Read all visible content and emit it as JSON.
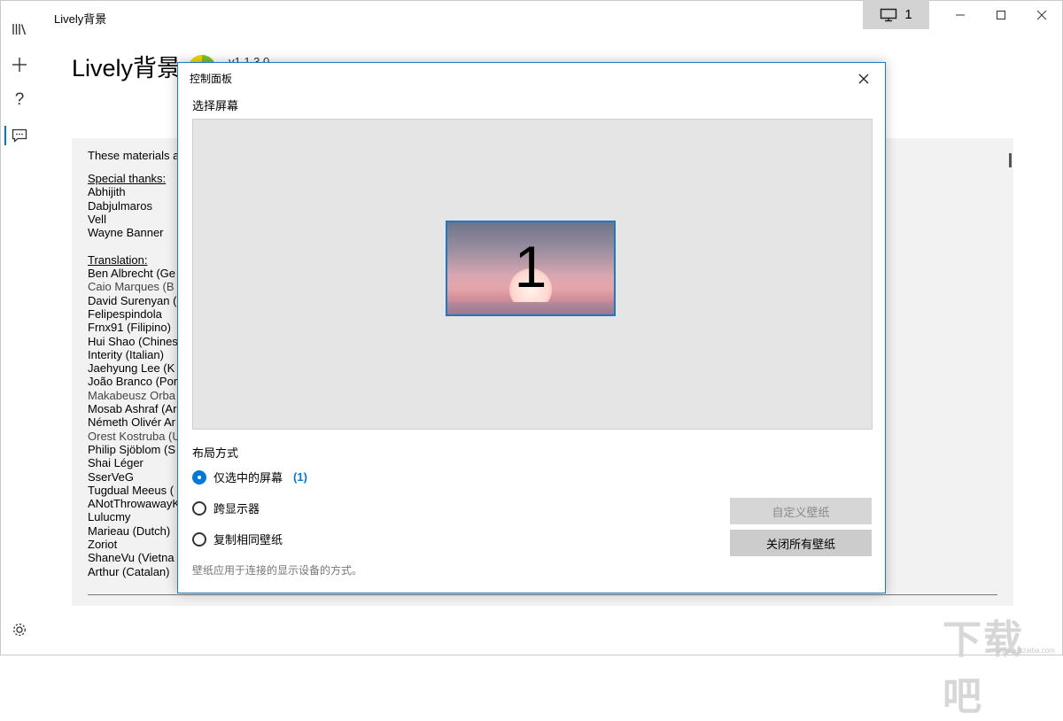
{
  "window": {
    "title": "Lively背景",
    "monitor_label": "1",
    "icons": {
      "monitor": "monitor-icon",
      "minimize": "minimize-icon",
      "maximize": "maximize-icon",
      "close": "close-icon"
    }
  },
  "sidebar": {
    "items": [
      {
        "name": "library",
        "icon": "library-icon"
      },
      {
        "name": "add",
        "icon": "plus-icon"
      },
      {
        "name": "help",
        "icon": "question-icon"
      },
      {
        "name": "about",
        "icon": "chat-icon",
        "active": true
      }
    ],
    "settings_icon": "gear-icon"
  },
  "main": {
    "title": "Lively背景",
    "version": "v1.1.3.0",
    "credits": {
      "intro": "These materials a",
      "special_thanks_header": "Special thanks:",
      "special_thanks": [
        "Abhijith",
        "Dabjulmaros",
        "Vell",
        "Wayne Banner"
      ],
      "translation_header": "Translation:",
      "translators": [
        "Ben Albrecht (Ge",
        "Caio Marques (B",
        "David Surenyan (",
        "Felipespindola",
        "Frnx91 (Filipino)",
        "Hui Shao (Chines",
        "Interity (Italian)",
        "Jaehyung Lee (K",
        "João Branco (Por",
        "Makabeusz Orba",
        "Mosab Ashraf (Ar",
        "Németh Olivér Ar",
        "Orest Kostruba (U",
        "Philip Sjöblom (S",
        "Shai Léger",
        "SserVeG",
        "Tugdual Meeus (",
        "ANotThrowawayK",
        "Lulucmy",
        "Marieau (Dutch)",
        "Zoriot",
        "ShaneVu (Vietna",
        "Arthur (Catalan)"
      ]
    }
  },
  "dialog": {
    "title": "控制面板",
    "close_icon": "close-icon",
    "select_screen_label": "选择屏幕",
    "screen": {
      "number": "1"
    },
    "layout_label": "布局方式",
    "layout_options": [
      {
        "label": "仅选中的屏幕",
        "count": "(1)",
        "selected": true
      },
      {
        "label": "跨显示器",
        "selected": false
      },
      {
        "label": "复制相同壁纸",
        "selected": false
      }
    ],
    "buttons": {
      "customize": {
        "label": "自定义壁纸",
        "enabled": false
      },
      "close_all": {
        "label": "关闭所有壁纸",
        "enabled": true
      }
    },
    "hint": "壁纸应用于连接的显示设备的方式。"
  },
  "watermark": {
    "text": "下载吧",
    "url": "www.xiazaiba.com"
  },
  "colors": {
    "accent": "#0078d7",
    "dialog_border": "#1e78c8",
    "panel_bg": "#f2f2f2",
    "screen_area_bg": "#e5e5e5"
  }
}
